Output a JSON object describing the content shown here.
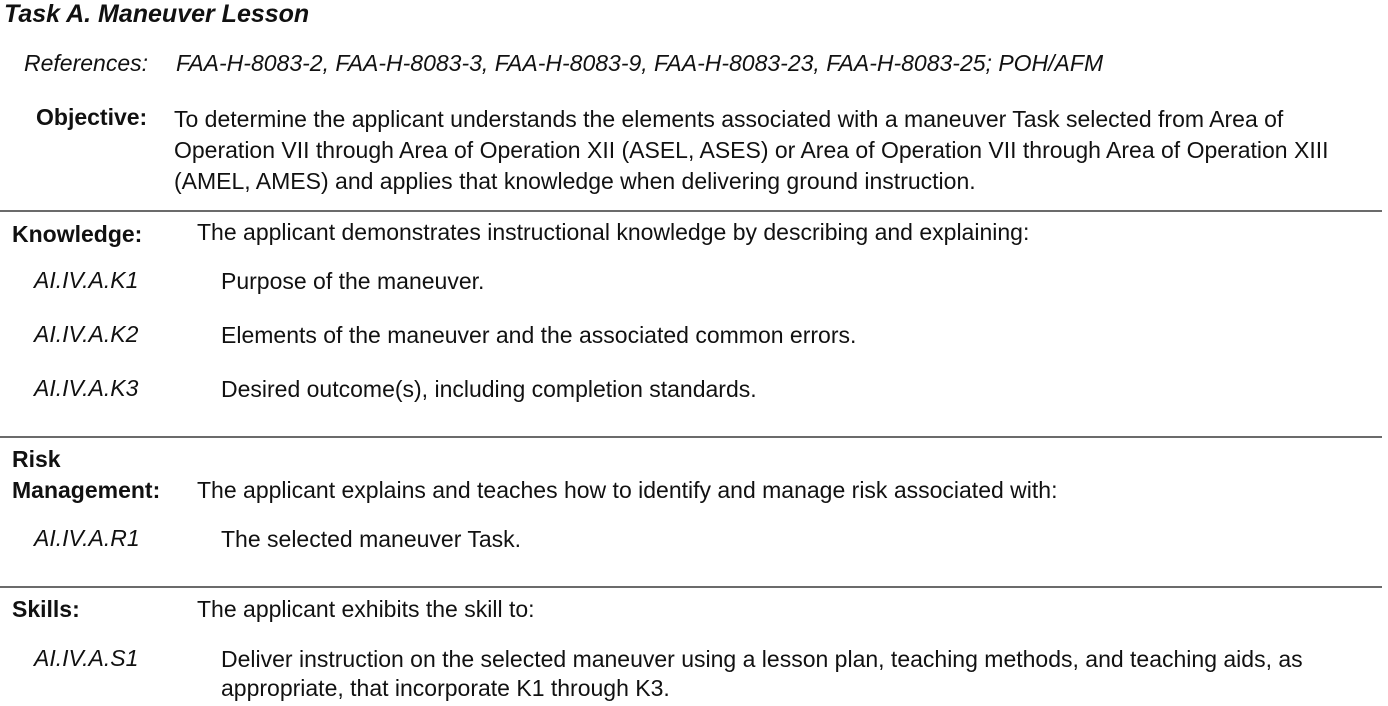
{
  "task": {
    "title": "Task A.  Maneuver Lesson",
    "references_label": "References:",
    "references_text": "FAA-H-8083-2, FAA-H-8083-3, FAA-H-8083-9, FAA-H-8083-23, FAA-H-8083-25; POH/AFM",
    "objective_label": "Objective:",
    "objective_text": "To determine the applicant understands the elements associated with a maneuver Task selected from Area of Operation VII through Area of Operation XII (ASEL, ASES) or Area of Operation VII through Area of Operation XIII (AMEL, AMES) and applies that knowledge when delivering ground instruction."
  },
  "knowledge": {
    "label": "Knowledge:",
    "intro": "The applicant demonstrates instructional knowledge by describing and explaining:",
    "items": [
      {
        "code": "AI.IV.A.K1",
        "text": "Purpose of the maneuver."
      },
      {
        "code": "AI.IV.A.K2",
        "text": "Elements of the maneuver and the associated common errors."
      },
      {
        "code": "AI.IV.A.K3",
        "text": "Desired outcome(s), including completion standards."
      }
    ]
  },
  "risk": {
    "label_line1": "Risk",
    "label_line2": "Management:",
    "intro": "The applicant explains and teaches how to identify and manage risk associated with:",
    "items": [
      {
        "code": "AI.IV.A.R1",
        "text": "The selected maneuver Task."
      }
    ]
  },
  "skills": {
    "label": "Skills:",
    "intro": "The applicant exhibits the skill to:",
    "items": [
      {
        "code": "AI.IV.A.S1",
        "text": "Deliver instruction on the selected maneuver using a lesson plan, teaching methods, and teaching aids, as appropriate, that incorporate K1 through K3."
      }
    ]
  }
}
